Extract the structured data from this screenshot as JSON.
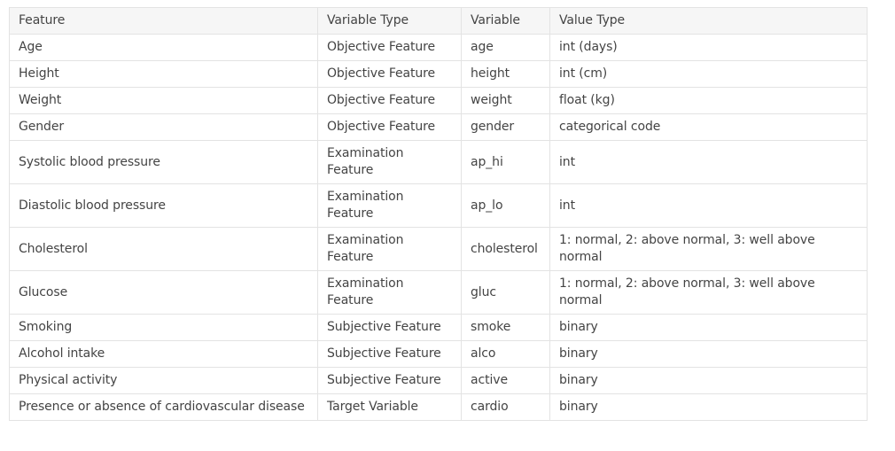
{
  "table": {
    "headers": [
      "Feature",
      "Variable Type",
      "Variable",
      "Value Type"
    ],
    "rows": [
      [
        "Age",
        "Objective Feature",
        "age",
        "int (days)"
      ],
      [
        "Height",
        "Objective Feature",
        "height",
        "int (cm)"
      ],
      [
        "Weight",
        "Objective Feature",
        "weight",
        "float (kg)"
      ],
      [
        "Gender",
        "Objective Feature",
        "gender",
        "categorical code"
      ],
      [
        "Systolic blood pressure",
        "Examination Feature",
        "ap_hi",
        "int"
      ],
      [
        "Diastolic blood pressure",
        "Examination Feature",
        "ap_lo",
        "int"
      ],
      [
        "Cholesterol",
        "Examination Feature",
        "cholesterol",
        "1: normal, 2: above normal, 3: well above normal"
      ],
      [
        "Glucose",
        "Examination Feature",
        "gluc",
        "1: normal, 2: above normal, 3: well above normal"
      ],
      [
        "Smoking",
        "Subjective Feature",
        "smoke",
        "binary"
      ],
      [
        "Alcohol intake",
        "Subjective Feature",
        "alco",
        "binary"
      ],
      [
        "Physical activity",
        "Subjective Feature",
        "active",
        "binary"
      ],
      [
        "Presence or absence of cardiovascular disease",
        "Target Variable",
        "cardio",
        "binary"
      ]
    ]
  },
  "colors": {
    "header_bg": "#f6f6f6",
    "border": "#e3e3e3",
    "text": "#444444"
  }
}
